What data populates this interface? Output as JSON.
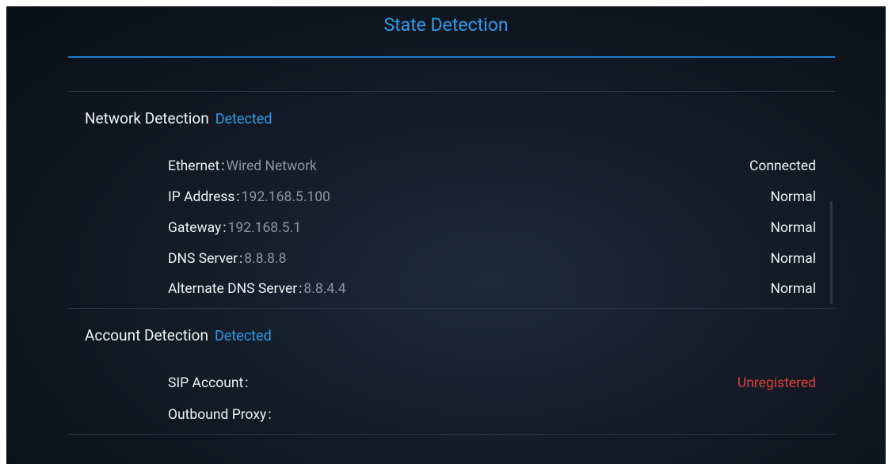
{
  "page": {
    "title": "State Detection"
  },
  "network": {
    "title": "Network Detection",
    "status": "Detected",
    "rows": [
      {
        "label": "Ethernet",
        "value": "Wired Network",
        "status": "Connected"
      },
      {
        "label": "IP Address",
        "value": "192.168.5.100",
        "status": "Normal"
      },
      {
        "label": "Gateway",
        "value": "192.168.5.1",
        "status": "Normal"
      },
      {
        "label": "DNS Server",
        "value": "8.8.8.8",
        "status": "Normal"
      },
      {
        "label": "Alternate DNS Server",
        "value": "8.8.4.4",
        "status": "Normal"
      }
    ]
  },
  "account": {
    "title": "Account Detection",
    "status": "Detected",
    "rows": [
      {
        "label": "SIP Account",
        "value": "",
        "status": "Unregistered"
      },
      {
        "label": "Outbound Proxy",
        "value": "",
        "status": ""
      }
    ]
  },
  "colors": {
    "accent": "#2f9be8",
    "error": "#d8413a",
    "background": "#141b27"
  }
}
